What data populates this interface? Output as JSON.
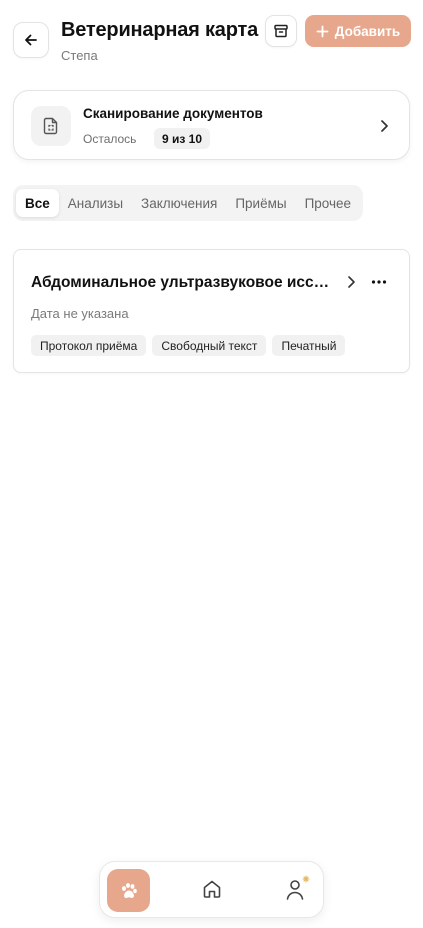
{
  "header": {
    "title": "Ветеринарная карта",
    "subtitle": "Степа",
    "add_label": "Добавить",
    "back_icon": "arrow-left-icon",
    "archive_icon": "archive-icon",
    "add_icon": "plus-icon"
  },
  "scan": {
    "title": "Сканирование документов",
    "remaining_label": "Осталось",
    "count": "9 из 10",
    "icon": "document-scan-icon"
  },
  "tabs": [
    {
      "label": "Все",
      "active": true
    },
    {
      "label": "Анализы",
      "active": false
    },
    {
      "label": "Заключения",
      "active": false
    },
    {
      "label": "Приёмы",
      "active": false
    },
    {
      "label": "Прочее",
      "active": false
    }
  ],
  "records": [
    {
      "title": "Абдоминальное ультразвуковое исследование",
      "date": "Дата не указана",
      "tags": [
        "Протокол приёма",
        "Свободный текст",
        "Печатный"
      ]
    }
  ],
  "nav": {
    "items": [
      "paw-icon",
      "home-icon",
      "user-icon"
    ],
    "active": "paw-icon"
  },
  "colors": {
    "accent": "#e6a78c",
    "chip_bg": "#f1f1f1",
    "border": "#e4e4e4"
  }
}
